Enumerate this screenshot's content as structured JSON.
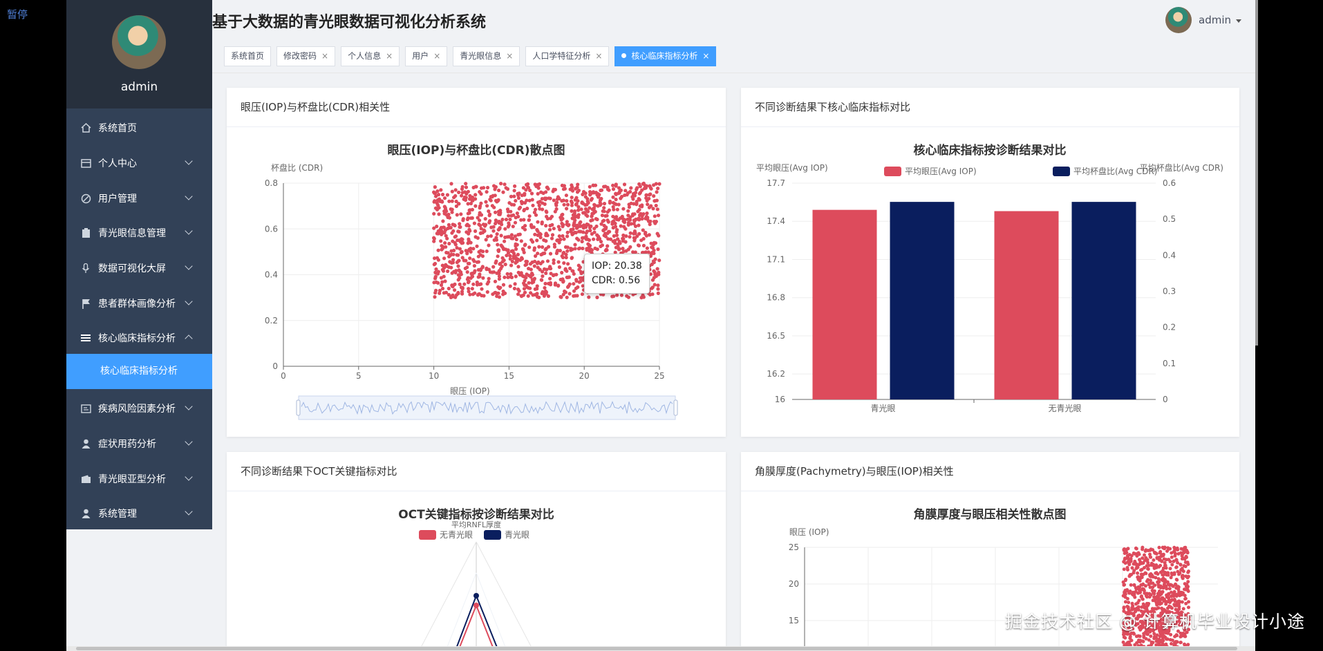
{
  "overlay": {
    "pause": "暂停",
    "watermark": "掘金技术社区 @ 计算机毕业设计小途"
  },
  "header": {
    "title": "基于大数据的青光眼数据可视化分析系统",
    "username": "admin"
  },
  "sidebar": {
    "username": "admin",
    "items": [
      {
        "label": "系统首页",
        "icon": "home-icon"
      },
      {
        "label": "个人中心",
        "icon": "card-icon"
      },
      {
        "label": "用户管理",
        "icon": "compass-icon"
      },
      {
        "label": "青光眼信息管理",
        "icon": "clipboard-icon"
      },
      {
        "label": "数据可视化大屏",
        "icon": "mic-icon"
      },
      {
        "label": "患者群体画像分析",
        "icon": "flag-icon"
      },
      {
        "label": "核心临床指标分析",
        "icon": "list-icon"
      },
      {
        "label": "疾病风险因素分析",
        "icon": "screen-icon"
      },
      {
        "label": "症状用药分析",
        "icon": "user-icon"
      },
      {
        "label": "青光眼亚型分析",
        "icon": "wallet-icon"
      },
      {
        "label": "系统管理",
        "icon": "user-icon"
      }
    ],
    "active_sub": "核心临床指标分析"
  },
  "tabs": [
    "系统首页",
    "修改密码",
    "个人信息",
    "用户",
    "青光眼信息",
    "人口学特征分析",
    "核心临床指标分析"
  ],
  "cards": {
    "c1": "眼压(IOP)与杯盘比(CDR)相关性",
    "c2": "不同诊断结果下核心临床指标对比",
    "c3": "不同诊断结果下OCT关键指标对比",
    "c4": "角膜厚度(Pachymetry)与眼压(IOP)相关性"
  },
  "tooltip": {
    "iop": "IOP: 20.38",
    "cdr": "CDR: 0.56"
  },
  "chart_data": [
    {
      "type": "scatter",
      "title": "眼压(IOP)与杯盘比(CDR)散点图",
      "xlabel": "眼压 (IOP)",
      "ylabel": "杯盘比 (CDR)",
      "xlim": [
        0,
        25
      ],
      "ylim": [
        0,
        0.8
      ],
      "xticks": [
        0,
        5,
        10,
        15,
        20,
        25
      ],
      "yticks": [
        0,
        0.2,
        0.4,
        0.6,
        0.8
      ],
      "point_region": {
        "x": [
          10,
          25
        ],
        "y": [
          0.3,
          0.8
        ]
      },
      "point_count": 1500,
      "color": "#dd4b5c",
      "datazoom": true
    },
    {
      "type": "bar",
      "title": "核心临床指标按诊断结果对比",
      "categories": [
        "青光眼",
        "无青光眼"
      ],
      "series": [
        {
          "name": "平均眼压(Avg IOP)",
          "axis": "left",
          "color": "#dd4b5c",
          "values": [
            17.49,
            17.48
          ]
        },
        {
          "name": "平均杯盘比(Avg CDR)",
          "axis": "right",
          "color": "#0a1e5e",
          "values": [
            0.548,
            0.548
          ]
        }
      ],
      "ylabel_left": "平均眼压(Avg IOP)",
      "ylabel_right": "平均杯盘比(Avg CDR)",
      "ylim_left": [
        16,
        17.7
      ],
      "yticks_left": [
        "16",
        "16.2",
        "16.5",
        "16.8",
        "17.1",
        "17.4",
        "17.7"
      ],
      "ylim_right": [
        0,
        0.6
      ],
      "yticks_right": [
        "0",
        "0.1",
        "0.2",
        "0.3",
        "0.4",
        "0.5",
        "0.6"
      ]
    },
    {
      "type": "radar",
      "title": "OCT关键指标按诊断结果对比",
      "axis_label": "平均RNFL厚度",
      "series": [
        {
          "name": "无青光眼",
          "color": "#dd4b5c"
        },
        {
          "name": "青光眼",
          "color": "#0a1e5e"
        }
      ]
    },
    {
      "type": "scatter",
      "title": "角膜厚度与眼压相关性散点图",
      "ylabel": "眼压 (IOP)",
      "yticks": [
        15,
        20,
        25
      ],
      "color": "#dd4b5c"
    }
  ]
}
